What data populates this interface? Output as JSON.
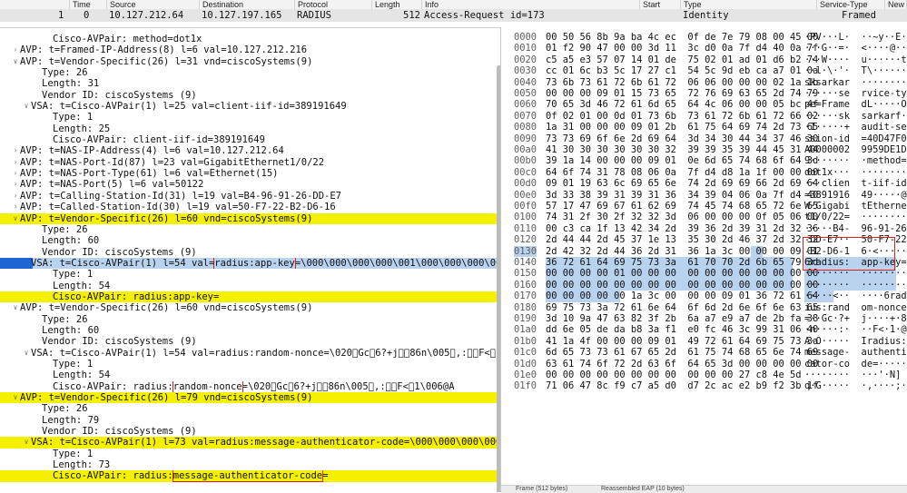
{
  "packet_list": {
    "columns": [
      "",
      "Time",
      "Source",
      "Destination",
      "Protocol",
      "Length",
      "Info",
      "Start",
      "Type",
      "Service-Type",
      "New C"
    ],
    "row": {
      "no": "1",
      "time": "0",
      "source": "10.127.212.64",
      "destination": "10.127.197.165",
      "protocol": "RADIUS",
      "length": "512",
      "info": "Access-Request id=173",
      "type": "Identity",
      "service_type": "Framed"
    }
  },
  "detail": {
    "lines": [
      {
        "indent": 4,
        "tw": "",
        "text": "Cisco-AVPair: method=dot1x"
      },
      {
        "indent": 1,
        "tw": ">",
        "text": "AVP: t=Framed-IP-Address(8) l=6 val=10.127.212.216"
      },
      {
        "indent": 1,
        "tw": "v",
        "text": "AVP: t=Vendor-Specific(26) l=31 vnd=ciscoSystems(9)"
      },
      {
        "indent": 3,
        "tw": "",
        "text": "Type: 26"
      },
      {
        "indent": 3,
        "tw": "",
        "text": "Length: 31"
      },
      {
        "indent": 3,
        "tw": "",
        "text": "Vendor ID: ciscoSystems (9)"
      },
      {
        "indent": 2,
        "tw": "v",
        "text": "VSA: t=Cisco-AVPair(1) l=25 val=client-iif-id=389191649"
      },
      {
        "indent": 4,
        "tw": "",
        "text": "Type: 1"
      },
      {
        "indent": 4,
        "tw": "",
        "text": "Length: 25"
      },
      {
        "indent": 4,
        "tw": "",
        "text": "Cisco-AVPair: client-iif-id=389191649"
      },
      {
        "indent": 1,
        "tw": ">",
        "text": "AVP: t=NAS-IP-Address(4) l=6 val=10.127.212.64"
      },
      {
        "indent": 1,
        "tw": ">",
        "text": "AVP: t=NAS-Port-Id(87) l=23 val=GigabitEthernet1/0/22"
      },
      {
        "indent": 1,
        "tw": ">",
        "text": "AVP: t=NAS-Port-Type(61) l=6 val=Ethernet(15)"
      },
      {
        "indent": 1,
        "tw": ">",
        "text": "AVP: t=NAS-Port(5) l=6 val=50122"
      },
      {
        "indent": 1,
        "tw": ">",
        "text": "AVP: t=Calling-Station-Id(31) l=19 val=B4-96-91-26-DD-E7"
      },
      {
        "indent": 1,
        "tw": ">",
        "text": "AVP: t=Called-Station-Id(30) l=19 val=50-F7-22-B2-D6-16"
      },
      {
        "indent": 1,
        "tw": "v",
        "text": "AVP: t=Vendor-Specific(26) l=60 vnd=ciscoSystems(9)",
        "hl": "yl"
      },
      {
        "indent": 3,
        "tw": "",
        "text": "Type: 26"
      },
      {
        "indent": 3,
        "tw": "",
        "text": "Length: 60"
      },
      {
        "indent": 3,
        "tw": "",
        "text": "Vendor ID: ciscoSystems (9)"
      },
      {
        "indent": 2,
        "tw": "v",
        "text": "VSA: t=Cisco-AVPair(1) l=54 val=",
        "box": "radius:app-key",
        "after": "=\\000\\000\\000\\000\\001\\000\\000\\000\\000\\000\\000",
        "hl": "bl",
        "sel": true
      },
      {
        "indent": 4,
        "tw": "",
        "text": "Type: 1"
      },
      {
        "indent": 4,
        "tw": "",
        "text": "Length: 54"
      },
      {
        "indent": 4,
        "tw": "",
        "text": "Cisco-AVPair: radius:app-key=",
        "hl": "yl"
      },
      {
        "indent": 1,
        "tw": "v",
        "text": "AVP: t=Vendor-Specific(26) l=60 vnd=ciscoSystems(9)"
      },
      {
        "indent": 3,
        "tw": "",
        "text": "Type: 26"
      },
      {
        "indent": 3,
        "tw": "",
        "text": "Length: 60"
      },
      {
        "indent": 3,
        "tw": "",
        "text": "Vendor ID: ciscoSystems (9)"
      },
      {
        "indent": 2,
        "tw": "v",
        "text": "VSA: t=Cisco-AVPair(1) l=54 val=radius:random-nonce=\\020\u0000Gc\u00066?+j\u0000\u000086n\\005\u0000,:\u0000\u0000F<\u00061\\006@A"
      },
      {
        "indent": 4,
        "tw": "",
        "text": "Type: 1"
      },
      {
        "indent": 4,
        "tw": "",
        "text": "Length: 54"
      },
      {
        "indent": 4,
        "tw": "",
        "text": "Cisco-AVPair: radius:",
        "box": "random-nonce",
        "after": "=\\020\u0000Gc\u00066?+j\u0000\u000086n\\005\u0000,:\u0000\u0000F<\u00061\\006@A"
      },
      {
        "indent": 1,
        "tw": "v",
        "text": "AVP: t=Vendor-Specific(26) l=79 vnd=ciscoSystems(9)",
        "hl": "yl"
      },
      {
        "indent": 3,
        "tw": "",
        "text": "Type: 26"
      },
      {
        "indent": 3,
        "tw": "",
        "text": "Length: 79"
      },
      {
        "indent": 3,
        "tw": "",
        "text": "Vendor ID: ciscoSystems (9)"
      },
      {
        "indent": 2,
        "tw": "v",
        "text": "VSA: t=Cisco-AVPair(1) l=73 val=radius:message-authenticator-code=\\000\\000\\000\\000\\000\\000\\000\\000",
        "hl": "yl"
      },
      {
        "indent": 4,
        "tw": "",
        "text": "Type: 1"
      },
      {
        "indent": 4,
        "tw": "",
        "text": "Length: 73"
      },
      {
        "indent": 4,
        "tw": "",
        "text": "Cisco-AVPair: radius:",
        "box": "message-authenticator-code",
        "after": "=",
        "hl": "yl"
      }
    ]
  },
  "hex": {
    "rows": [
      {
        "off": "0000",
        "bytes": "00 50 56 8b 9a ba 4c ec  0f de 7e 79 08 00 45 00",
        "ascii": "·PV···L·  ··~y··E·"
      },
      {
        "off": "0010",
        "bytes": "01 f2 90 47 00 00 3d 11  3c d0 0a 7f d4 40 0a 7f",
        "ascii": "···G··=·  <····@··"
      },
      {
        "off": "0020",
        "bytes": "c5 a5 e3 57 07 14 01 de  75 02 01 ad 01 d6 b2 74",
        "ascii": "···W····  u······t"
      },
      {
        "off": "0030",
        "bytes": "cc 01 6c b3 5c 17 27 c1  54 5c 9d eb ca a7 01 0a",
        "ascii": "··l·\\·'·  T\\······"
      },
      {
        "off": "0040",
        "bytes": "73 6b 73 61 72 6b 61 72  06 06 00 00 00 02 1a 1b",
        "ascii": "sksarkar  ········"
      },
      {
        "off": "0050",
        "bytes": "00 00 00 09 01 15 73 65  72 76 69 63 65 2d 74 79",
        "ascii": "······se  rvice-ty"
      },
      {
        "off": "0060",
        "bytes": "70 65 3d 46 72 61 6d 65  64 4c 06 00 00 05 bc 4f",
        "ascii": "pe=Frame  dL·····O"
      },
      {
        "off": "0070",
        "bytes": "0f 02 01 00 0d 01 73 6b  73 61 72 6b 61 72 66 02",
        "ascii": "······sk  sarkarf·"
      },
      {
        "off": "0080",
        "bytes": "1a 31 00 00 00 09 01 2b  61 75 64 69 74 2d 73 65",
        "ascii": "·1·····+  audit-se"
      },
      {
        "off": "0090",
        "bytes": "73 73 69 6f 6e 2d 69 64  3d 34 30 44 34 37 46 30",
        "ascii": "ssion-id  =40D47F0"
      },
      {
        "off": "00a0",
        "bytes": "41 30 30 30 30 30 30 32  39 39 35 39 44 45 31 44",
        "ascii": "A0000002  9959DE1D"
      },
      {
        "off": "00b0",
        "bytes": "39 1a 14 00 00 00 09 01  0e 6d 65 74 68 6f 64 3d",
        "ascii": "9·······  ·method="
      },
      {
        "off": "00c0",
        "bytes": "64 6f 74 31 78 08 06 0a  7f d4 d8 1a 1f 00 00 00",
        "ascii": "dot1x···  ········"
      },
      {
        "off": "00d0",
        "bytes": "09 01 19 63 6c 69 65 6e  74 2d 69 69 66 2d 69 64",
        "ascii": "···clien  t-iif-id"
      },
      {
        "off": "00e0",
        "bytes": "3d 33 38 39 31 39 31 36  34 39 04 06 0a 7f d4 40",
        "ascii": "=3891916  49·····@"
      },
      {
        "off": "00f0",
        "bytes": "57 17 47 69 67 61 62 69  74 45 74 68 65 72 6e 65",
        "ascii": "W·Gigabi  tEtherne"
      },
      {
        "off": "0100",
        "bytes": "74 31 2f 30 2f 32 32 3d  06 00 00 00 0f 05 06 00",
        "ascii": "t1/0/22=  ········"
      },
      {
        "off": "0110",
        "bytes": "00 c3 ca 1f 13 42 34 2d  39 36 2d 39 31 2d 32 36",
        "ascii": "·····B4-  96-91-26"
      },
      {
        "off": "0120",
        "bytes": "2d 44 44 2d 45 37 1e 13  35 30 2d 46 37 2d 32 32",
        "ascii": "-DD-E7··  50-F7-22"
      },
      {
        "off": "0130",
        "bytes": "2d 42 32 2d 44 36 2d 31  36 1a 3c 00 00 00 09 01",
        "ascii": "-B2-D6-1  6·<·····"
      },
      {
        "off": "0140",
        "bytes": "36 72 61 64 69 75 73 3a  61 70 70 2d 6b 65 79 3d",
        "ascii": "6radius:  app-key="
      },
      {
        "off": "0150",
        "bytes": "00 00 00 00 01 00 00 00  00 00 00 00 00 00 00 00",
        "ascii": "········  ········"
      },
      {
        "off": "0160",
        "bytes": "00 00 00 00 00 00 00 00  00 00 00 00 00 00 00 00",
        "ascii": "········  ········"
      },
      {
        "off": "0170",
        "bytes": "00 00 00 00 00 1a 3c 00  00 00 09 01 36 72 61 64",
        "ascii": "·····<··  ····6rad"
      },
      {
        "off": "0180",
        "bytes": "69 75 73 3a 72 61 6e 64  6f 6d 2d 6e 6f 6e 63 65",
        "ascii": "ius:rand  om-nonce"
      },
      {
        "off": "0190",
        "bytes": "3d 10 9a 47 63 82 3f 2b  6a a7 e9 a7 de 2b fa 38",
        "ascii": "=··Gc·?+  j····+·8"
      },
      {
        "off": "01a0",
        "bytes": "dd 6e 05 de da b8 3a f1  e0 fc 46 3c 99 31 06 40",
        "ascii": "·n····:·  ··F<·1·@"
      },
      {
        "off": "01b0",
        "bytes": "41 1a 4f 00 00 00 09 01  49 72 61 64 69 75 73 3a",
        "ascii": "A·O·····  Iradius:"
      },
      {
        "off": "01c0",
        "bytes": "6d 65 73 73 61 67 65 2d  61 75 74 68 65 6e 74 69",
        "ascii": "message-  authenti"
      },
      {
        "off": "01d0",
        "bytes": "63 61 74 6f 72 2d 63 6f  64 65 3d 00 00 00 00 00",
        "ascii": "cator-co  de=·····"
      },
      {
        "off": "01e0",
        "bytes": "00 00 00 00 00 00 00 00  00 00 00 27 c8 4e 5d",
        "ascii": "········  ···'·N]"
      },
      {
        "off": "01f0",
        "bytes": "71 06 47 8c f9 c7 a5 d0  d7 2c ac e2 b9 f2 3b 1f",
        "ascii": "q·G·····  ·,····;·"
      }
    ]
  },
  "tabs": [
    "Frame (512 bytes)",
    "Reassembled EAP (10 bytes)"
  ]
}
